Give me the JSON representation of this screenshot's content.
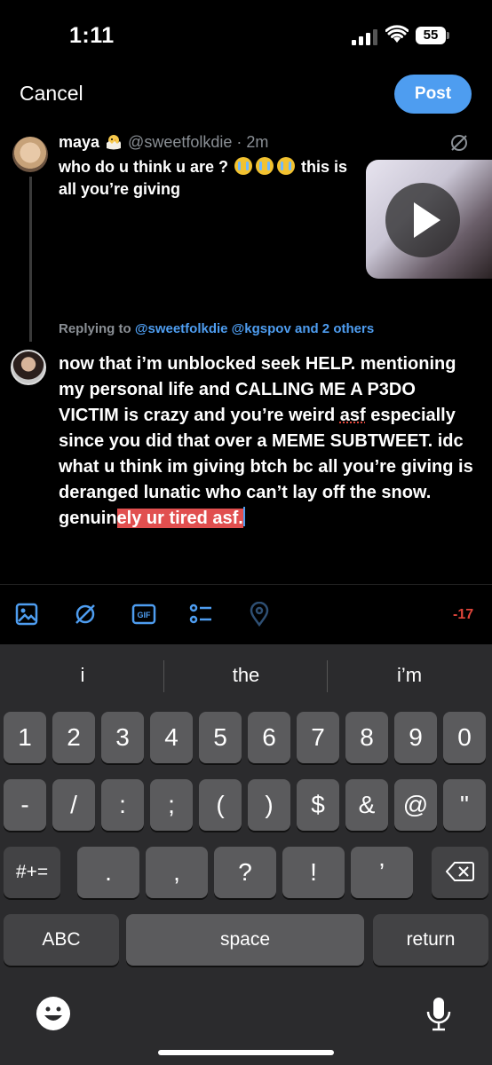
{
  "status_bar": {
    "time": "1:11",
    "battery": "55"
  },
  "header": {
    "cancel_label": "Cancel",
    "post_label": "Post"
  },
  "original_tweet": {
    "name": "maya",
    "handle": "@sweetfolkdie",
    "age": "· 2m",
    "text_before": "who do u think u are ? ",
    "text_after": " this is all you’re giving"
  },
  "replying": {
    "prefix": "Replying to",
    "mentions": "@sweetfolkdie @kgspov and 2 others"
  },
  "reply": {
    "text_part1": "now that i’m unblocked seek HELP. mentioning my personal life and CALLING ME A P3DO VICTIM is crazy and you’re weird ",
    "misspelled": "asf",
    "text_part2": " especially since you did that over a MEME SUBTWEET. idc what u think im giving btch bc all you’re giving is deranged lunatic who can’t lay off the snow. genuin",
    "highlighted": "ely ur tired asf."
  },
  "toolbar": {
    "counter": "-17"
  },
  "keyboard": {
    "suggestions": [
      "i",
      "the",
      "i’m"
    ],
    "row1": [
      "1",
      "2",
      "3",
      "4",
      "5",
      "6",
      "7",
      "8",
      "9",
      "0"
    ],
    "row2": [
      "-",
      "/",
      ":",
      ";",
      "(",
      ")",
      "$",
      "&",
      "@",
      "\""
    ],
    "row3_shift": "#+=",
    "row3": [
      ".",
      ",",
      "?",
      "!",
      "’"
    ],
    "abc_label": "ABC",
    "space_label": "space",
    "return_label": "return"
  },
  "colors": {
    "accent": "#4e9df0",
    "highlight": "#e14f4f",
    "warning": "#e0453a"
  }
}
